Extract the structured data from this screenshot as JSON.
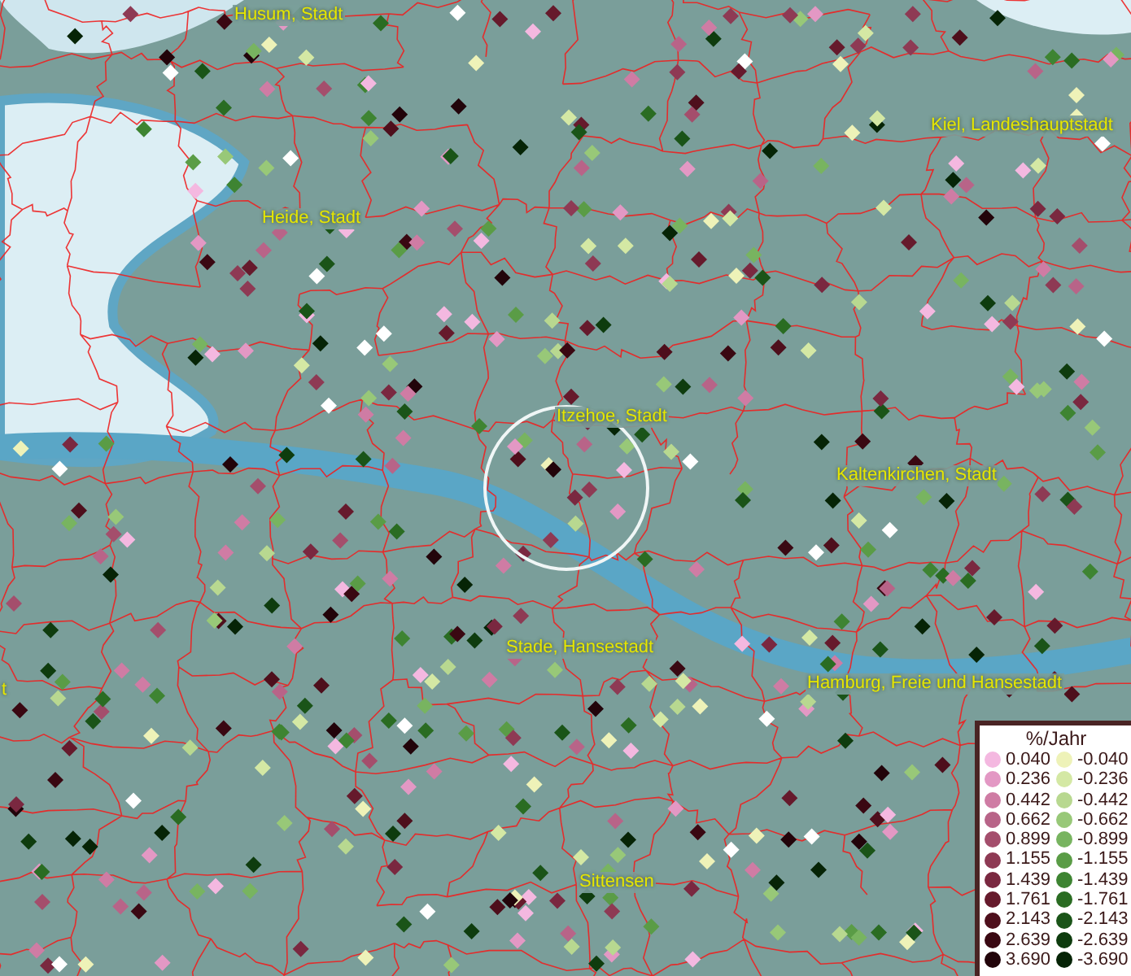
{
  "map": {
    "place_labels": [
      {
        "text": "Husum, Stadt"
      },
      {
        "text": "Heide, Stadt"
      },
      {
        "text": "Kiel, Landeshauptstadt"
      },
      {
        "text": "Itzehoe, Stadt"
      },
      {
        "text": "Kaltenkirchen, Stadt"
      },
      {
        "text": "t"
      },
      {
        "text": "Stade, Hansestadt"
      },
      {
        "text": "Hamburg, Freie und Hansestadt"
      },
      {
        "text": "Sittensen"
      }
    ]
  },
  "legend": {
    "title": "%/Jahr",
    "positive": [
      {
        "label": "0.040",
        "color": "#f4b8e0"
      },
      {
        "label": "0.236",
        "color": "#e398c4"
      },
      {
        "label": "0.442",
        "color": "#cf7ca4"
      },
      {
        "label": "0.662",
        "color": "#b86488"
      },
      {
        "label": "0.899",
        "color": "#a44e6c"
      },
      {
        "label": "1.155",
        "color": "#8e3a54"
      },
      {
        "label": "1.439",
        "color": "#7a2840"
      },
      {
        "label": "1.761",
        "color": "#661a2c"
      },
      {
        "label": "2.143",
        "color": "#4e0f1c"
      },
      {
        "label": "2.639",
        "color": "#3a0812"
      },
      {
        "label": "3.690",
        "color": "#22040a"
      }
    ],
    "negative": [
      {
        "label": "-0.040",
        "color": "#eef2b8"
      },
      {
        "label": "-0.236",
        "color": "#d4e8a4"
      },
      {
        "label": "-0.442",
        "color": "#b8d890"
      },
      {
        "label": "-0.662",
        "color": "#98c878"
      },
      {
        "label": "-0.899",
        "color": "#78b460"
      },
      {
        "label": "-1.155",
        "color": "#5a9c46"
      },
      {
        "label": "-1.439",
        "color": "#3e8432"
      },
      {
        "label": "-1.761",
        "color": "#2a6c22"
      },
      {
        "label": "-2.143",
        "color": "#1a5418"
      },
      {
        "label": "-2.639",
        "color": "#0e3c0e"
      },
      {
        "label": "-3.690",
        "color": "#062406"
      }
    ]
  }
}
